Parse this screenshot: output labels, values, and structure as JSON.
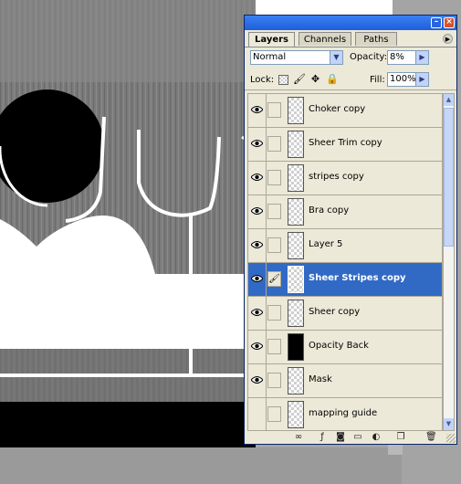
{
  "palette": {
    "tabs": [
      {
        "label": "Layers",
        "active": true
      },
      {
        "label": "Channels",
        "active": false
      },
      {
        "label": "Paths",
        "active": false
      }
    ],
    "blend_mode": "Normal",
    "opacity_label": "Opacity:",
    "opacity_value": "8%",
    "lock_label": "Lock:",
    "fill_label": "Fill:",
    "fill_value": "100%",
    "layers": [
      {
        "name": "Choker copy",
        "visible": true,
        "thumb": "checker"
      },
      {
        "name": "Sheer Trim copy",
        "visible": true,
        "thumb": "checker"
      },
      {
        "name": "stripes copy",
        "visible": true,
        "thumb": "checker"
      },
      {
        "name": "Bra copy",
        "visible": true,
        "thumb": "checker"
      },
      {
        "name": "Layer 5",
        "visible": true,
        "thumb": "checker"
      },
      {
        "name": "Sheer Stripes copy",
        "visible": true,
        "thumb": "checker",
        "selected": true,
        "brush": true
      },
      {
        "name": "Sheer copy",
        "visible": true,
        "thumb": "checker"
      },
      {
        "name": "Opacity Back",
        "visible": true,
        "thumb": "black"
      },
      {
        "name": "Mask",
        "visible": true,
        "thumb": "checker"
      },
      {
        "name": "mapping guide",
        "visible": false,
        "thumb": "checker"
      }
    ]
  },
  "colors": {
    "selection": "#316ac5",
    "titlebar": "#1f5fd8",
    "panel": "#ece9d8"
  }
}
